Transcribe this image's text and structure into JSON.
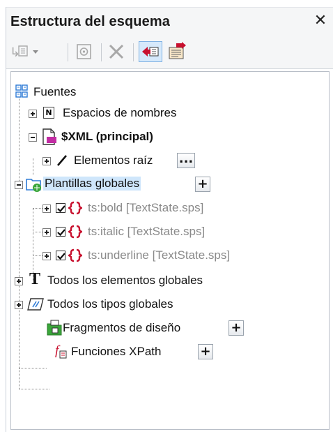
{
  "panel": {
    "title": "Estructura del esquema",
    "close_glyph": "✕"
  },
  "toolbar": {
    "buttons": [
      {
        "name": "add-module-icon"
      },
      {
        "name": "module-properties-icon"
      },
      {
        "name": "delete-icon"
      },
      {
        "name": "collapse-all-icon"
      },
      {
        "name": "expand-all-icon"
      }
    ]
  },
  "tree": {
    "root": {
      "label": "Fuentes",
      "icon": "sources-icon"
    },
    "namespaces": {
      "label": "Espacios de nombres",
      "icon_text": "N"
    },
    "xml_main": {
      "label": "$XML (principal)"
    },
    "root_elements": {
      "label": "Elementos raíz",
      "button": "..."
    },
    "global_templates": {
      "label": "Plantillas globales",
      "button": "+"
    },
    "templates": [
      {
        "label": "ts:bold [TextState.sps]",
        "checked": true
      },
      {
        "label": "ts:italic [TextState.sps]",
        "checked": true
      },
      {
        "label": "ts:underline [TextState.sps]",
        "checked": true
      }
    ],
    "all_elements": {
      "label": "Todos los elementos globales",
      "icon_text": "T"
    },
    "all_types": {
      "label": "Todos los tipos globales"
    },
    "design_fragments": {
      "label": "Fragmentos de diseño",
      "button": "+"
    },
    "xpath_functions": {
      "label": "Funciones XPath",
      "button": "+"
    }
  },
  "colors": {
    "selection": "#cfe6fb",
    "accent_red": "#c8102e",
    "folder_blue": "#2e7bd6",
    "fragment_green": "#3aa63a"
  }
}
